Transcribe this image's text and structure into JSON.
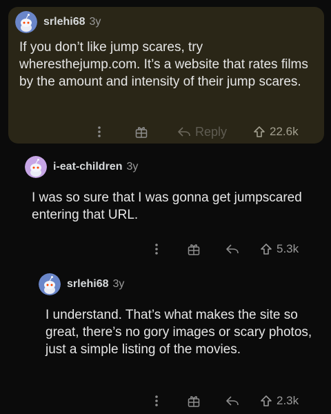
{
  "comments": [
    {
      "username": "srlehi68",
      "age": "3y",
      "text": "If you don’t like jump scares, try wheresthejump.com. It’s a website that rates films by the amount and intensity of their jump scares.",
      "reply_label": "Reply",
      "upvotes": "22.6k",
      "avatar_color": "#6a86c9",
      "highlighted": true
    },
    {
      "username": "i-eat-children",
      "age": "3y",
      "text": "I was so sure that I was gonna get jumpscared entering that URL.",
      "upvotes": "5.3k",
      "avatar_color": "#c7a6e6"
    },
    {
      "username": "srlehi68",
      "age": "3y",
      "text": "I understand. That’s what makes the site so great, there’s no gory images or scary photos, just a simple listing of the movies.",
      "upvotes": "2.3k",
      "avatar_color": "#6a86c9"
    }
  ],
  "icons": {
    "more": "more-vertical-icon",
    "award": "award-icon",
    "reply": "reply-arrow-icon",
    "upvote": "upvote-arrow-icon",
    "avatar": "snoo-avatar-icon"
  },
  "colors": {
    "background": "#0b0b0b",
    "highlight_background": "#2a2617"
  }
}
